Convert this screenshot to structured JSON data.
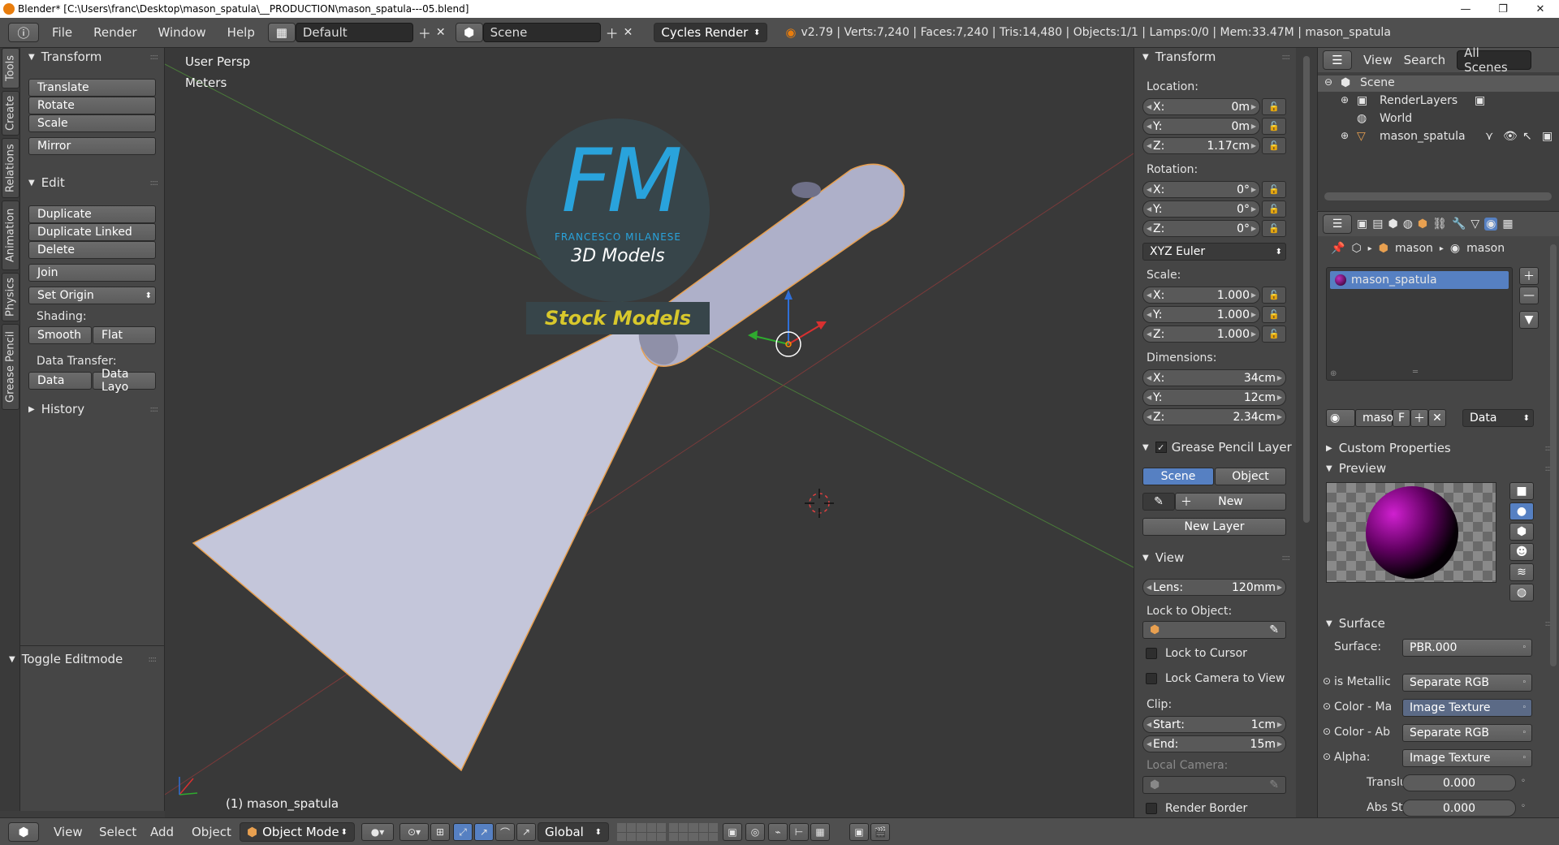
{
  "window": {
    "title": "Blender* [C:\\Users\\franc\\Desktop\\mason_spatula\\__PRODUCTION\\mason_spatula---05.blend]",
    "minimize": "—",
    "maximize": "❐",
    "close": "✕"
  },
  "infobar": {
    "menus": [
      "File",
      "Render",
      "Window",
      "Help"
    ],
    "layout": "Default",
    "scene": "Scene",
    "engine": "Cycles Render",
    "stats": "v2.79 | Verts:7,240 | Faces:7,240 | Tris:14,480 | Objects:1/1 | Lamps:0/0 | Mem:33.47M | mason_spatula"
  },
  "tabs": [
    "Tools",
    "Create",
    "Relations",
    "Animation",
    "Physics",
    "Grease Pencil"
  ],
  "toolshelf": {
    "transform_title": "Transform",
    "translate": "Translate",
    "rotate": "Rotate",
    "scale": "Scale",
    "mirror": "Mirror",
    "edit_title": "Edit",
    "duplicate": "Duplicate",
    "duplicate_linked": "Duplicate Linked",
    "delete": "Delete",
    "join": "Join",
    "set_origin": "Set Origin",
    "shading_label": "Shading:",
    "smooth": "Smooth",
    "flat": "Flat",
    "data_transfer_label": "Data Transfer:",
    "data": "Data",
    "data_layout": "Data Layo",
    "history_title": "History",
    "toggle_editmode": "Toggle Editmode"
  },
  "viewport": {
    "view_name": "User Persp",
    "units": "Meters",
    "object_label": "(1) mason_spatula",
    "logo": {
      "initials": "FM",
      "name": "FRANCESCO MILANESE",
      "sub": "3D Models",
      "banner": "Stock Models"
    }
  },
  "npanel": {
    "transform_title": "Transform",
    "location_label": "Location:",
    "location": {
      "x": "0m",
      "y": "0m",
      "z": "1.17cm"
    },
    "rotation_label": "Rotation:",
    "rotation": {
      "x": "0°",
      "y": "0°",
      "z": "0°"
    },
    "rotation_mode": "XYZ Euler",
    "scale_label": "Scale:",
    "scale": {
      "x": "1.000",
      "y": "1.000",
      "z": "1.000"
    },
    "dimensions_label": "Dimensions:",
    "dimensions": {
      "x": "34cm",
      "y": "12cm",
      "z": "2.34cm"
    },
    "axis_x": "X:",
    "axis_y": "Y:",
    "axis_z": "Z:",
    "grease_title": "Grease Pencil Layer",
    "scene_btn": "Scene",
    "object_btn": "Object",
    "new_btn": "New",
    "new_layer_btn": "New Layer",
    "view_title": "View",
    "lens_label": "Lens:",
    "lens_value": "120mm",
    "lock_to_object": "Lock to Object:",
    "lock_to_cursor": "Lock to Cursor",
    "lock_camera": "Lock Camera to View",
    "clip_label": "Clip:",
    "start_label": "Start:",
    "start_value": "1cm",
    "end_label": "End:",
    "end_value": "15m",
    "local_camera": "Local Camera:",
    "render_border": "Render Border"
  },
  "outliner": {
    "view": "View",
    "search": "Search",
    "all_scenes": "All Scenes",
    "items": [
      "Scene",
      "RenderLayers",
      "World",
      "mason_spatula"
    ]
  },
  "properties": {
    "breadcrumb_1": "mason",
    "breadcrumb_2": "mason",
    "material_slot": "mason_spatula",
    "material_name": "maso",
    "f_label": "F",
    "data_select": "Data",
    "custom_props": "Custom Properties",
    "preview": "Preview",
    "surface_title": "Surface",
    "surface_label": "Surface:",
    "surface_value": "PBR.000",
    "inputs": [
      {
        "label": "is Metallic",
        "value": "Separate RGB"
      },
      {
        "label": "Color - Ma",
        "value": "Image Texture"
      },
      {
        "label": "Color - Ab",
        "value": "Separate RGB"
      },
      {
        "label": "Alpha:",
        "value": "Image Texture"
      }
    ],
    "translucency_label": "Transluce",
    "translucency_value": "0.000",
    "abs_label": "Abs Stren",
    "abs_value": "0.000"
  },
  "statusbar": {
    "view": "View",
    "select": "Select",
    "add": "Add",
    "object": "Object",
    "mode": "Object Mode",
    "orientation": "Global"
  },
  "colors": {
    "accent": "#5680c2",
    "spatula": "#c4c6da",
    "selection_outline": "#e8a050",
    "logo_blue": "#29a3dc",
    "logo_yellow": "#d8c82c"
  }
}
